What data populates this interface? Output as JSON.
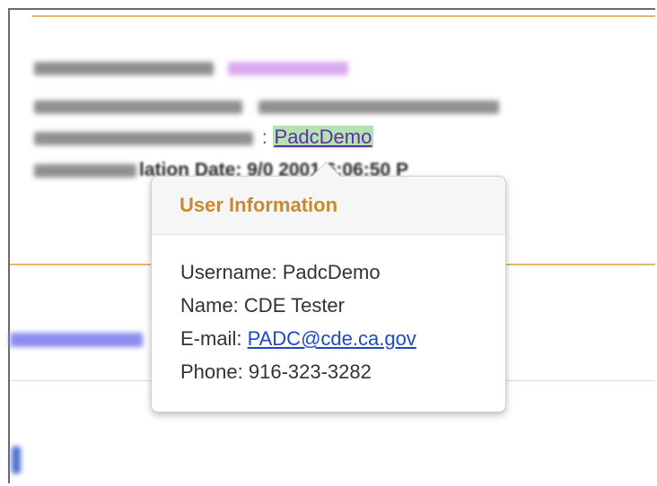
{
  "record": {
    "last_validation_by_user": "PadcDemo",
    "last_validation_date_partial": "lation Date: 9/0  2001 6:06:50 P"
  },
  "user_popover": {
    "title": "User Information",
    "username_label": "Username:",
    "username": "PadcDemo",
    "name_label": "Name:",
    "name": "CDE Tester",
    "email_label": "E-mail:",
    "email": "PADC@cde.ca.gov",
    "phone_label": "Phone:",
    "phone": "916-323-3282"
  },
  "colors": {
    "accent_gold": "#e7b66b",
    "popover_title": "#c98a2e",
    "link_blue": "#1d48c9",
    "link_highlight": "#b4e3b2"
  }
}
